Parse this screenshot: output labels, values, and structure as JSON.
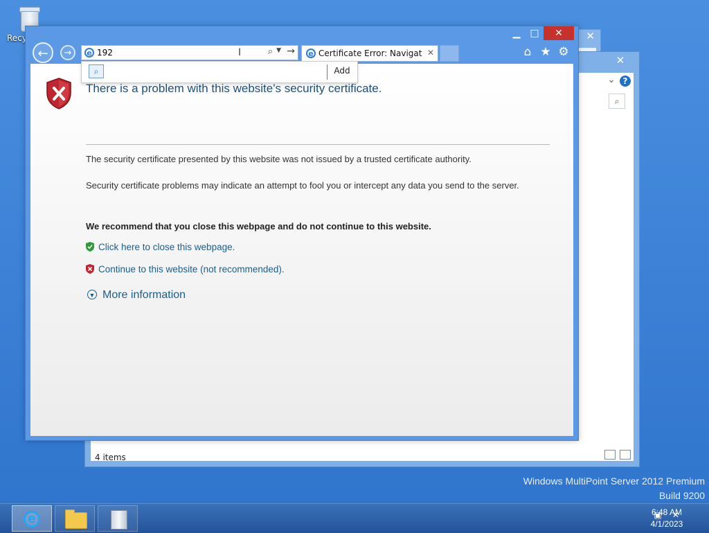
{
  "desktop": {
    "recycle_bin_label": "Recyc",
    "watermark_line1": "Windows MultiPoint Server 2012 Premium",
    "watermark_line2": "Build 9200"
  },
  "explorer": {
    "status_text": "4 items",
    "close_glyph": "✕",
    "help_glyph": "?"
  },
  "ie": {
    "address_value": "192",
    "tab_title": "Certificate Error: Navigation...",
    "suggest_add_label": "Add",
    "caption": {
      "min": "▁",
      "max": "□",
      "close": "✕"
    }
  },
  "page": {
    "title": "There is a problem with this website's security certificate.",
    "para1": "The security certificate presented by this website was not issued by a trusted certificate authority.",
    "para2": "Security certificate problems may indicate an attempt to fool you or intercept any data you send to the server.",
    "warning": "We recommend that you close this webpage and do not continue to this website.",
    "close_link": "Click here to close this webpage.",
    "continue_link": "Continue to this website (not recommended).",
    "more_info": "More information"
  },
  "taskbar": {
    "time": "6:48 AM",
    "date": "4/1/2023"
  },
  "colors": {
    "desktop": "#2f74cc",
    "window_frame": "#5b99e6",
    "close_button": "#c7312b",
    "link": "#1a5e8c",
    "title_text": "#1f4e79",
    "shield_red": "#c0262d",
    "shield_green": "#2e9a3a"
  }
}
